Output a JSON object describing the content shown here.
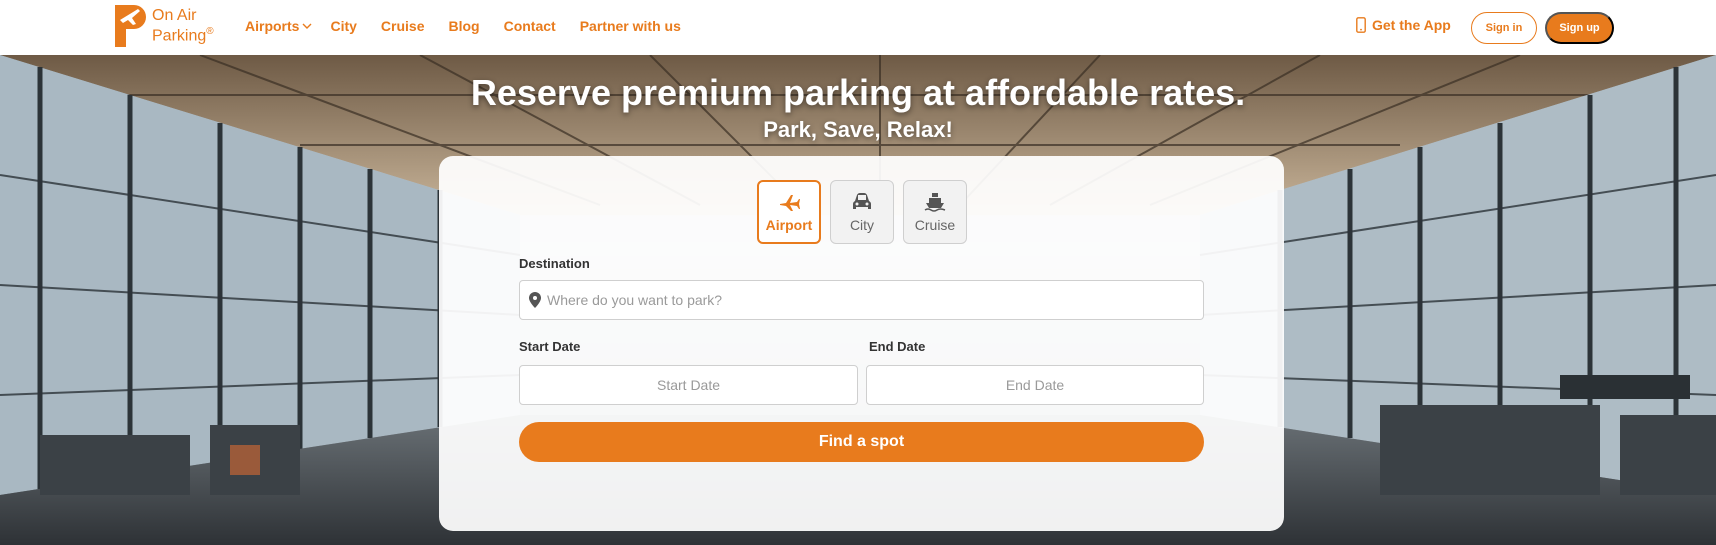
{
  "brand": {
    "line1": "On Air",
    "line2": "Parking",
    "reg": "®",
    "color": "#e87b1d"
  },
  "nav": {
    "links": [
      "Airports",
      "City",
      "Cruise",
      "Blog",
      "Contact",
      "Partner with us"
    ],
    "get_app": "Get the App",
    "sign_in": "Sign in",
    "sign_up": "Sign up"
  },
  "hero": {
    "headline": "Reserve premium parking at affordable rates.",
    "subline": "Park, Save, Relax!"
  },
  "search": {
    "tabs": [
      {
        "label": "Airport",
        "icon": "plane-icon",
        "active": true
      },
      {
        "label": "City",
        "icon": "car-icon",
        "active": false
      },
      {
        "label": "Cruise",
        "icon": "ship-icon",
        "active": false
      }
    ],
    "destination_label": "Destination",
    "destination_placeholder": "Where do you want to park?",
    "start_label": "Start Date",
    "start_placeholder": "Start Date",
    "end_label": "End Date",
    "end_placeholder": "End Date",
    "submit": "Find a spot"
  }
}
